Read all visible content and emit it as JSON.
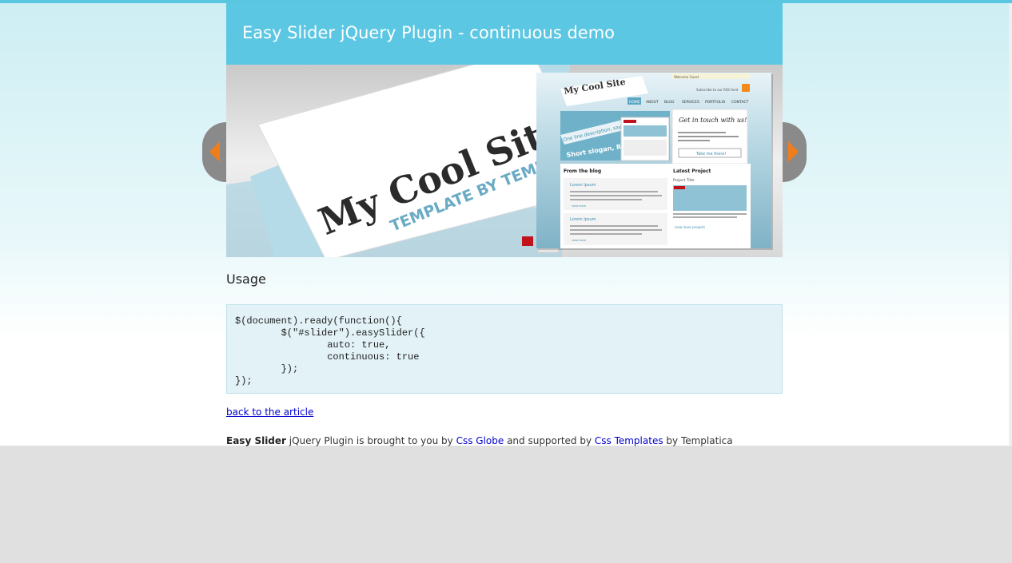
{
  "header": {
    "title": "Easy Slider jQuery Plugin - continuous demo"
  },
  "slider": {
    "slide_logo": "My Cool Site",
    "slide_tagline": "TEMPLATE BY TEMPLATICA",
    "preview": {
      "welcome": "Welcome Guest",
      "rss": "Subscribe to our RSS feed",
      "nav": [
        "HOME",
        "ABOUT",
        "BLOG",
        "SERVICES",
        "PORTFOLIO",
        "CONTACT"
      ],
      "slogan": "Short slogan, Re",
      "desc_line": "One line description, say",
      "contact_heading": "Get in touch with us!",
      "contact_button": "Take me there!",
      "blog_heading": "From the blog",
      "blog_post": "Lorem Ipsum",
      "read_more": "read more",
      "project_heading": "Latest Project",
      "project_title": "Project Title",
      "more_projects": "view more projects"
    },
    "prev_label": "Previous",
    "next_label": "Next"
  },
  "usage": {
    "title": "Usage",
    "code": "$(document).ready(function(){\n\t$(\"#slider\").easySlider({\n\t\tauto: true,\n\t\tcontinuous: true\n\t});\n});"
  },
  "links": {
    "back": "back to the article"
  },
  "credits": {
    "brand": "Easy Slider",
    "text1": " jQuery Plugin is brought to you by ",
    "link1": "Css Globe",
    "text2": " and supported by ",
    "link2": "Css Templates",
    "text3": " by Templatica"
  },
  "colors": {
    "accent": "#5cc7e2",
    "arrow": "#f07c1b",
    "code_bg": "#e2f2f7"
  }
}
